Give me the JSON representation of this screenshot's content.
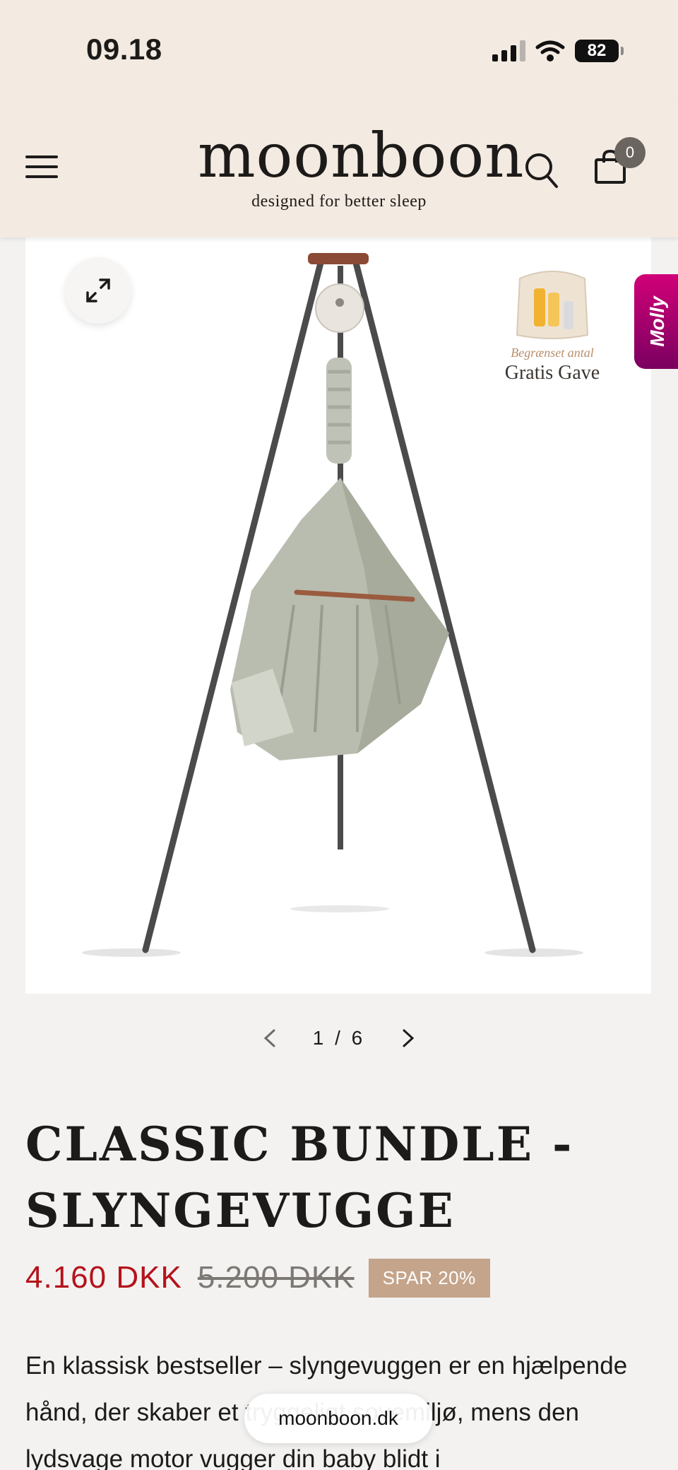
{
  "status_bar": {
    "time": "09.18",
    "battery": "82",
    "icons": [
      "cellular-signal-icon",
      "wifi-icon",
      "battery-icon"
    ]
  },
  "header": {
    "brand_name": "moonboon",
    "brand_tagline": "designed for better sleep",
    "cart_count": "0",
    "icons": [
      "hamburger-menu-icon",
      "search-icon",
      "shopping-bag-icon"
    ]
  },
  "gallery": {
    "gift_note": "Begrænset antal",
    "gift_title": "Gratis Gave",
    "counter": "1 / 6",
    "icons": [
      "expand-icon",
      "chevron-left-icon",
      "chevron-right-icon"
    ]
  },
  "side_tab": {
    "label": "Molly"
  },
  "product": {
    "title": "CLASSIC BUNDLE - SLYNGEVUGGE",
    "price": "4.160 DKK",
    "old_price": "5.200 DKK",
    "discount": "SPAR 20%",
    "description": "En klassisk bestseller – slyngevuggen er en hjælpende hånd, der skaber et tryggeligt sovemiljø, mens den lydsvage motor vugger din baby blidt i"
  },
  "browser": {
    "url": "moonboon.dk"
  },
  "colors": {
    "header_bg": "#f3eae1",
    "page_bg": "#f3f2f0",
    "price_red": "#b5121b",
    "badge_tan": "#c4a48a",
    "molly_magenta": "#c3006f"
  }
}
